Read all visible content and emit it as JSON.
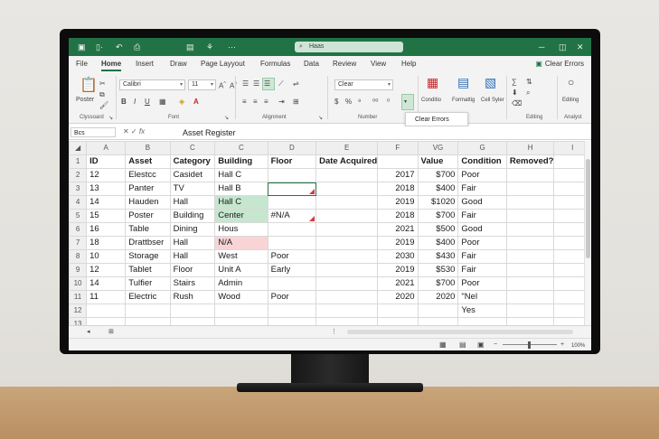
{
  "titlebar": {
    "search_text": "Haas"
  },
  "menu": {
    "tabs": [
      "File",
      "Home",
      "Insert",
      "Draw",
      "Page Layyout",
      "Formulas",
      "Data",
      "Review",
      "View",
      "Help"
    ],
    "active": "Home",
    "clear_errors": "Clear Errors"
  },
  "ribbon": {
    "font_name": "Calibri",
    "font_size": "11",
    "number_format": "Clear",
    "poster_label": "Poster",
    "groups": [
      "Clyssoard",
      "Font",
      "Alignment",
      "Number",
      "Editing",
      "Analyst"
    ],
    "conditional_label": "Conditio",
    "formatting_label": "Formattig",
    "cell_label": "Cell Syler",
    "editing_label": "Editing",
    "popup_item": "Clear Errors"
  },
  "formula_bar": {
    "name_box": "Bcs",
    "fx": "fx",
    "content": "Asset Register"
  },
  "grid": {
    "columns": [
      "A",
      "B",
      "C",
      "C",
      "D",
      "E",
      "F",
      "VG",
      "G",
      "H",
      "I"
    ],
    "rows": [
      {
        "n": "1",
        "cells": [
          "ID",
          "Asset",
          "Category",
          "Building",
          "Floor",
          "Date Acquired",
          "",
          "Value",
          "Condition",
          "Removed?",
          ""
        ]
      },
      {
        "n": "2",
        "cells": [
          "12",
          "Elestcc",
          "Casidet",
          "Hall C",
          "",
          "",
          "2017",
          "$700",
          "Poor",
          "",
          ""
        ]
      },
      {
        "n": "3",
        "cells": [
          "13",
          "Panter",
          "TV",
          "Hall B",
          "",
          "",
          "2018",
          "$400",
          "Fair",
          "",
          ""
        ]
      },
      {
        "n": "4",
        "cells": [
          "14",
          "Hauden",
          "Hall",
          "Hall C",
          "",
          "",
          "2019",
          "$1020",
          "Good",
          "",
          ""
        ]
      },
      {
        "n": "5",
        "cells": [
          "15",
          "Poster",
          "Building",
          "Center",
          "#N/A",
          "",
          "2018",
          "$700",
          "Fair",
          "",
          ""
        ]
      },
      {
        "n": "6",
        "cells": [
          "16",
          "Table",
          "Dining",
          "Hous",
          "",
          "",
          "2021",
          "$500",
          "Good",
          "",
          ""
        ]
      },
      {
        "n": "7",
        "cells": [
          "18",
          "Drattbser",
          "Hall",
          "N/A",
          "",
          "",
          "2019",
          "$400",
          "Poor",
          "",
          ""
        ]
      },
      {
        "n": "8",
        "cells": [
          "10",
          "Storage",
          "Hall",
          "West",
          "Poor",
          "",
          "2030",
          "$430",
          "Fair",
          "",
          ""
        ]
      },
      {
        "n": "9",
        "cells": [
          "12",
          "Tablet",
          "Floor",
          "Unit A",
          "Early",
          "",
          "2019",
          "$530",
          "Fair",
          "",
          ""
        ]
      },
      {
        "n": "10",
        "cells": [
          "14",
          "Tulfier",
          "Stairs",
          "Admin",
          "",
          "",
          "2021",
          "$700",
          "Poor",
          "",
          ""
        ]
      },
      {
        "n": "11",
        "cells": [
          "11",
          "Electric",
          "Rush",
          "Wood",
          "Poor",
          "",
          "2020",
          "2020",
          "\"Nel",
          "",
          ""
        ]
      },
      {
        "n": "12",
        "cells": [
          "",
          "",
          "",
          "",
          "",
          "",
          "",
          "",
          "Yes",
          "",
          ""
        ]
      },
      {
        "n": "13",
        "cells": [
          "",
          "",
          "",
          "",
          "",
          "",
          "",
          "",
          "",
          "",
          ""
        ]
      }
    ]
  },
  "status": {
    "zoom": "100%"
  },
  "colors": {
    "accent": "#217346",
    "error_fill": "#f8d4d7",
    "ok_fill": "#c6e6cf"
  }
}
